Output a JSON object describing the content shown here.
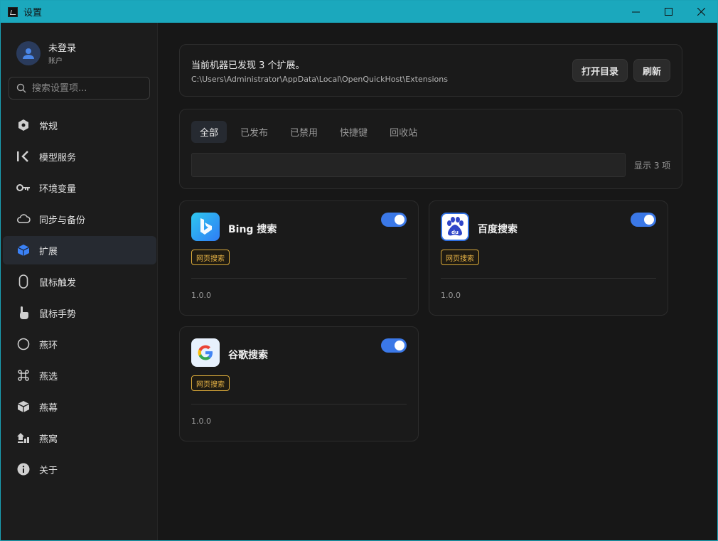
{
  "window": {
    "title": "设置",
    "buttons": [
      "minimize",
      "maximize",
      "close"
    ]
  },
  "account": {
    "name": "未登录",
    "subtitle": "账户"
  },
  "search": {
    "placeholder": "搜索设置项..."
  },
  "sidebar": {
    "items": [
      {
        "label": "常规",
        "icon": "hexagon-icon"
      },
      {
        "label": "模型服务",
        "icon": "model-icon"
      },
      {
        "label": "环境变量",
        "icon": "key-icon"
      },
      {
        "label": "同步与备份",
        "icon": "cloud-icon"
      },
      {
        "label": "扩展",
        "icon": "cube-icon",
        "active": true
      },
      {
        "label": "鼠标触发",
        "icon": "mouse-icon"
      },
      {
        "label": "鼠标手势",
        "icon": "pointer-hand-icon"
      },
      {
        "label": "燕环",
        "icon": "ring-icon"
      },
      {
        "label": "燕选",
        "icon": "command-icon"
      },
      {
        "label": "燕幕",
        "icon": "box-icon"
      },
      {
        "label": "燕窝",
        "icon": "nest-icon"
      },
      {
        "label": "关于",
        "icon": "info-icon"
      }
    ]
  },
  "info": {
    "title": "当前机器已发现 3 个扩展。",
    "path": "C:\\Users\\Administrator\\AppData\\Local\\OpenQuickHost\\Extensions",
    "open_dir_label": "打开目录",
    "refresh_label": "刷新"
  },
  "filter": {
    "tabs": [
      "全部",
      "已发布",
      "已禁用",
      "快捷键",
      "回收站"
    ],
    "active_tab": 0,
    "input_value": "",
    "count_label": "显示 3 项"
  },
  "extensions": [
    {
      "name": "Bing 搜索",
      "tag": "网页搜索",
      "version": "1.0.0",
      "enabled": true,
      "icon": "bing-icon"
    },
    {
      "name": "百度搜索",
      "tag": "网页搜索",
      "version": "1.0.0",
      "enabled": true,
      "icon": "baidu-icon"
    },
    {
      "name": "谷歌搜索",
      "tag": "网页搜索",
      "version": "1.0.0",
      "enabled": true,
      "icon": "google-icon"
    }
  ],
  "colors": {
    "titlebar": "#1ba8bd",
    "accent": "#3b78e7",
    "tag": "#e8b446",
    "background": "#171717"
  }
}
